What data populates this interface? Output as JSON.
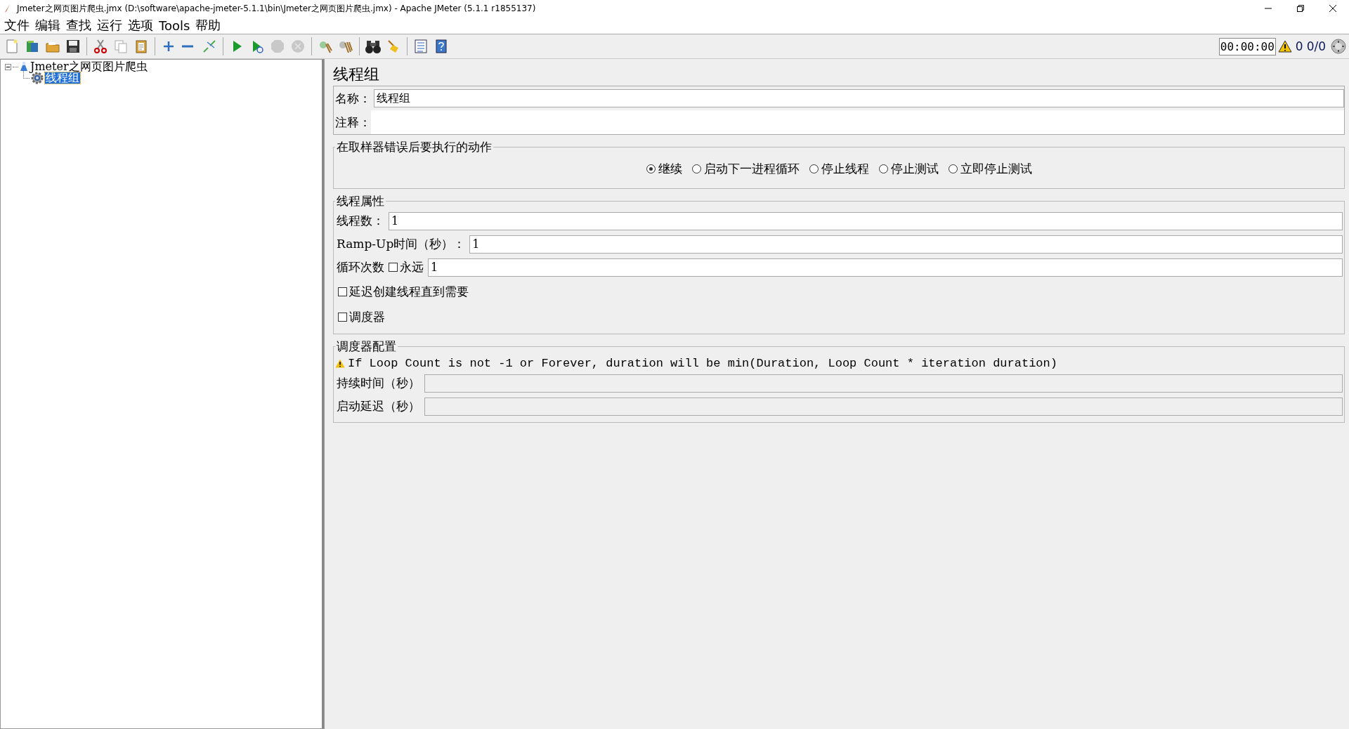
{
  "window": {
    "title": "Jmeter之网页图片爬虫.jmx (D:\\software\\apache-jmeter-5.1.1\\bin\\Jmeter之网页图片爬虫.jmx) - Apache JMeter (5.1.1 r1855137)"
  },
  "menu": [
    "文件",
    "编辑",
    "查找",
    "运行",
    "选项",
    "Tools",
    "帮助"
  ],
  "toolbar": [
    {
      "kind": "new",
      "disabled": false
    },
    {
      "kind": "templates",
      "disabled": false
    },
    {
      "kind": "open",
      "disabled": false
    },
    {
      "kind": "save",
      "disabled": false
    },
    {
      "kind": "separator"
    },
    {
      "kind": "cut",
      "disabled": false
    },
    {
      "kind": "copy",
      "disabled": false
    },
    {
      "kind": "paste",
      "disabled": false
    },
    {
      "kind": "separator"
    },
    {
      "kind": "expand",
      "disabled": false
    },
    {
      "kind": "collapse",
      "disabled": false
    },
    {
      "kind": "toggle",
      "disabled": false
    },
    {
      "kind": "separator"
    },
    {
      "kind": "start",
      "disabled": false
    },
    {
      "kind": "start-no-pause",
      "disabled": false
    },
    {
      "kind": "stop",
      "disabled": true
    },
    {
      "kind": "shutdown",
      "disabled": true
    },
    {
      "kind": "separator"
    },
    {
      "kind": "clear",
      "disabled": false
    },
    {
      "kind": "clear-all",
      "disabled": false
    },
    {
      "kind": "separator"
    },
    {
      "kind": "search",
      "disabled": false
    },
    {
      "kind": "reset-search",
      "disabled": false
    },
    {
      "kind": "separator"
    },
    {
      "kind": "function-helper",
      "disabled": false
    },
    {
      "kind": "help",
      "disabled": false
    }
  ],
  "status": {
    "timer": "00:00:00",
    "errors": "0",
    "threads": "0/0"
  },
  "tree": [
    {
      "label": "Jmeter之网页图片爬虫",
      "expanded": true,
      "selected": false,
      "children": [
        {
          "label": "线程组",
          "selected": true
        }
      ]
    }
  ],
  "form": {
    "title": "线程组",
    "name": {
      "label": "名称：",
      "value": "线程组"
    },
    "comment": {
      "label": "注释："
    },
    "on_error": {
      "legend": "在取样器错误后要执行的动作",
      "options": [
        {
          "label": "继续",
          "selected": true
        },
        {
          "label": "启动下一进程循环",
          "selected": false
        },
        {
          "label": "停止线程",
          "selected": false
        },
        {
          "label": "停止测试",
          "selected": false
        },
        {
          "label": "立即停止测试",
          "selected": false
        }
      ]
    },
    "thread_properties": {
      "legend": "线程属性",
      "threads": {
        "label": "线程数：",
        "value": "1"
      },
      "ramp_up": {
        "label": "Ramp-Up时间（秒）：",
        "value": "1"
      },
      "loop": {
        "label": "循环次数",
        "forever_label": "永远",
        "forever_checked": false,
        "value": "1"
      },
      "checkboxes": [
        {
          "label": "延迟创建线程直到需要",
          "checked": false
        },
        {
          "label": "调度器",
          "checked": false
        }
      ]
    },
    "scheduler": {
      "legend": "调度器配置",
      "warning": "If Loop Count is not -1 or Forever, duration will be min(Duration, Loop Count * iteration duration)",
      "fields": [
        {
          "label": "持续时间（秒）",
          "disabled": true
        },
        {
          "label": "启动延迟（秒）",
          "disabled": true
        }
      ]
    }
  }
}
